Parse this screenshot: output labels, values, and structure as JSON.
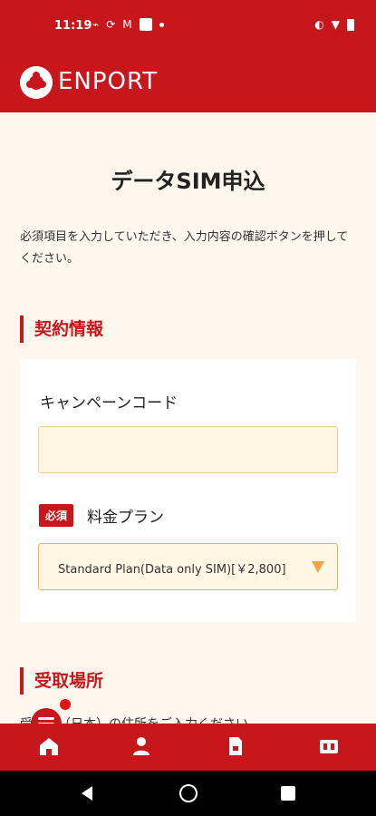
{
  "status_bar": {
    "time": "11:19"
  },
  "header": {
    "logo_text": "ENPORT"
  },
  "page": {
    "title": "データSIM申込",
    "intro": "必須項目を入力していただき、入力内容の確認ボタンを押してください。"
  },
  "contract_section": {
    "title": "契約情報",
    "campaign_code_label": "キャンペーンコード",
    "campaign_code_value": "",
    "required_badge": "必須",
    "plan_label": "料金プラン",
    "plan_value": "Standard Plan(Data only SIM)[￥2,800]"
  },
  "receiving_section": {
    "title": "受取場所",
    "description": "受　所（日本）の住所をご入力ください。"
  },
  "colors": {
    "brand": "#c8161d",
    "field_bg": "#fff6e4",
    "accent": "#f1a33d"
  }
}
